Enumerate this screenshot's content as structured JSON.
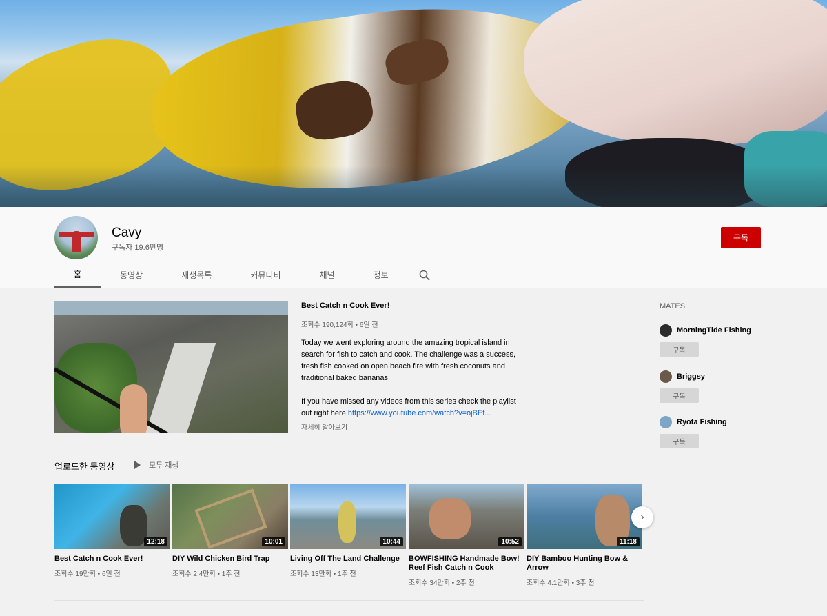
{
  "channel": {
    "name": "Cavy",
    "subscribers": "구독자 19.6만명",
    "subscribe_label": "구독"
  },
  "tabs": [
    {
      "label": "홈",
      "active": true
    },
    {
      "label": "동영상"
    },
    {
      "label": "재생목록"
    },
    {
      "label": "커뮤니티"
    },
    {
      "label": "채널"
    },
    {
      "label": "정보"
    }
  ],
  "featured": {
    "title": "Best Catch n Cook Ever!",
    "meta": "조회수 190,124회 • 6일 전",
    "desc_p1": "Today we went exploring around the amazing tropical island in search for fish to catch and cook. The challenge was a success, fresh fish cooked on open beach fire with fresh coconuts and traditional baked bananas!",
    "desc_p2": "If you have missed any videos from this series check the playlist out right here ",
    "desc_link": "https://www.youtube.com/watch?v=ojBEf...",
    "more_label": "자세히 알아보기"
  },
  "uploads": {
    "title": "업로드한 동영상",
    "play_all": "모두 재생",
    "videos": [
      {
        "title": "Best Catch n Cook Ever!",
        "duration": "12:18",
        "meta": "조회수 19만회 • 6일 전"
      },
      {
        "title": "DIY Wild Chicken Bird Trap",
        "duration": "10:01",
        "meta": "조회수 2.4만회 • 1주 전"
      },
      {
        "title": "Living Off The Land Challenge",
        "duration": "10:44",
        "meta": "조회수 13만회 • 1주 전"
      },
      {
        "title": "BOWFISHING Handmade Bow! Reef Fish Catch n Cook",
        "duration": "10:52",
        "meta": "조회수 34만회 • 2주 전"
      },
      {
        "title": "DIY Bamboo Hunting Bow & Arrow",
        "duration": "11:18",
        "meta": "조회수 4.1만회 • 3주 전"
      }
    ]
  },
  "sidebar": {
    "title": "MATES",
    "mates": [
      {
        "name": "MorningTide Fishing",
        "subscribe": "구독",
        "avatar_color": "#2b2b2b"
      },
      {
        "name": "Briggsy",
        "subscribe": "구독",
        "avatar_color": "#6b5a4a"
      },
      {
        "name": "Ryota Fishing",
        "subscribe": "구독",
        "avatar_color": "#7ea6c4"
      }
    ]
  },
  "colors": {
    "subscribe_red": "#cc0000",
    "link_blue": "#065fd4"
  },
  "icons": {
    "search": "search-icon",
    "next": "chevron-right-icon",
    "play": "play-icon"
  }
}
